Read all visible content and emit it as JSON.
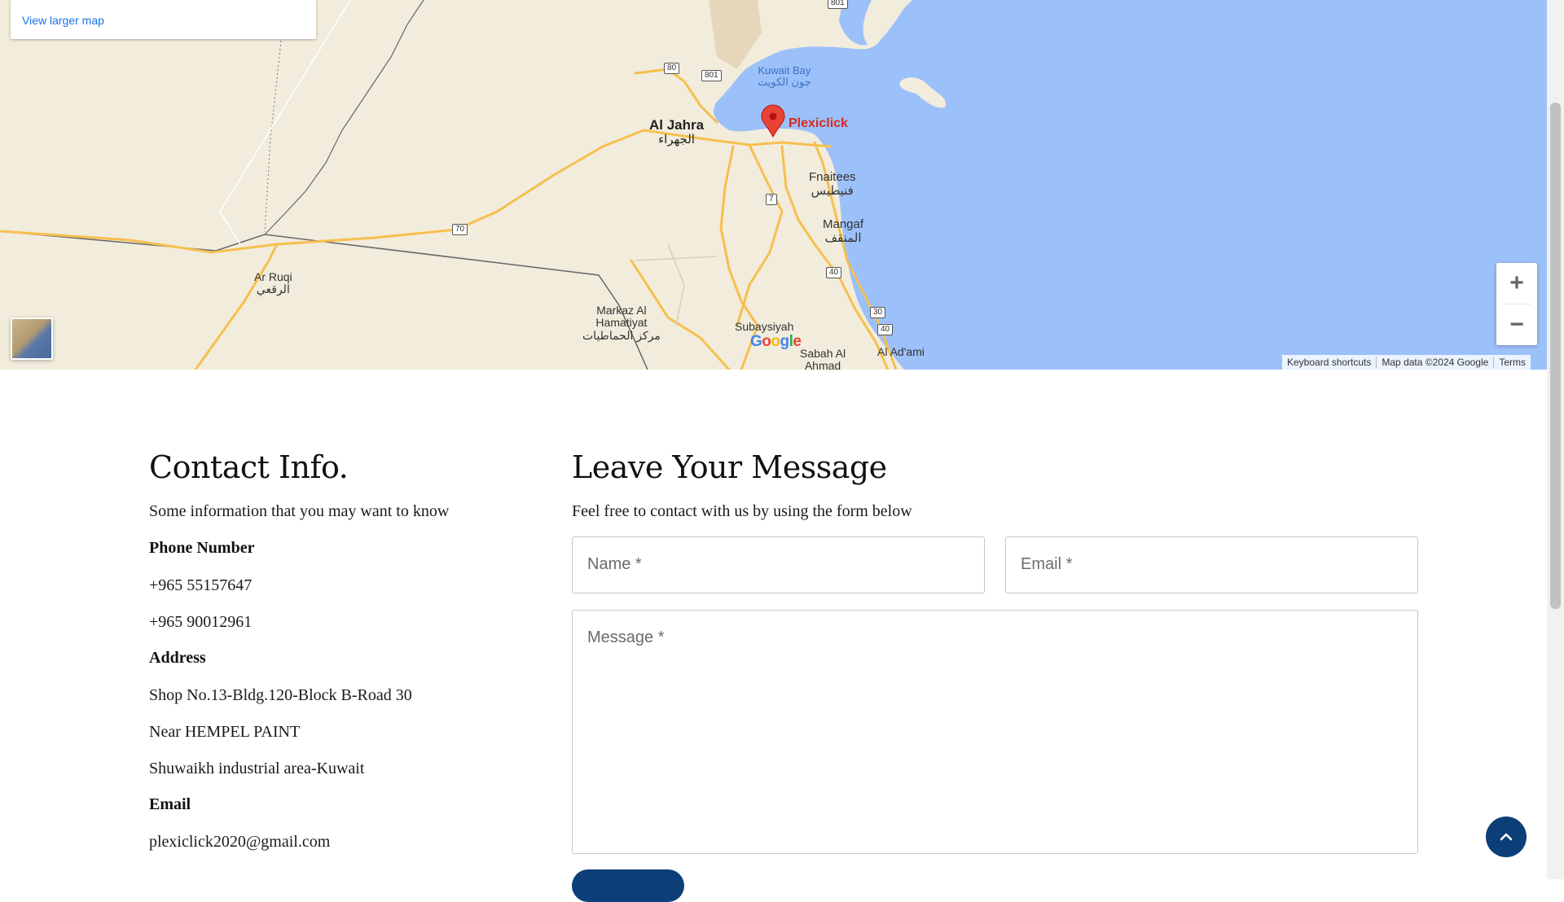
{
  "map": {
    "view_larger_label": "View larger map",
    "marker_label": "Plexiclick",
    "places": {
      "al_jahra": "Al Jahra",
      "al_jahra_ar": "الجهراء",
      "kuwait_bay": "Kuwait Bay",
      "kuwait_bay_ar": "جون الكويت",
      "fnaitees": "Fnaitees",
      "fnaitees_ar": "فنيطيس",
      "mangaf": "Mangaf",
      "mangaf_ar": "المنقف",
      "ar_ruqi": "Ar Ruqi",
      "ar_ruqi_ar": "الرقعي",
      "markaz_1": "Markaz Al",
      "markaz_2": "Hamatiyat",
      "markaz_ar": "مركز الحماطيات",
      "subaysiyah": "Subaysiyah",
      "sabah_al_ahmad_1": "Sabah Al",
      "sabah_al_ahmad_2": "Ahmad",
      "al_adami": "Al Ad'ami"
    },
    "road_shields": [
      "801",
      "80",
      "801",
      "70",
      "7",
      "40",
      "30",
      "40"
    ],
    "zoom_in": "+",
    "zoom_out": "−",
    "google_logo_letters": [
      "G",
      "o",
      "o",
      "g",
      "l",
      "e"
    ],
    "google_logo_colors": [
      "#4285F4",
      "#EA4335",
      "#FBBC05",
      "#4285F4",
      "#34A853",
      "#EA4335"
    ],
    "attribution": {
      "shortcuts": "Keyboard shortcuts",
      "data": "Map data ©2024 Google",
      "terms": "Terms"
    },
    "colors": {
      "land": "#f2ecdc",
      "water": "#9cc0f9",
      "road": "#f6c04e",
      "marker": "#ea4335"
    }
  },
  "contact_info": {
    "title": "Contact Info.",
    "subtitle": "Some information that you may want to know",
    "phone_label": "Phone Number",
    "phones": [
      "+965 55157647",
      "+965 90012961"
    ],
    "address_label": "Address",
    "address_lines": [
      "Shop No.13-Bldg.120-Block B-Road 30",
      "Near HEMPEL PAINT",
      "Shuwaikh industrial area-Kuwait"
    ],
    "email_label": "Email",
    "email": "plexiclick2020@gmail.com"
  },
  "message_form": {
    "title": "Leave Your Message",
    "subtitle": "Feel free to contact with us by using the form below",
    "name_placeholder": "Name *",
    "email_placeholder": "Email *",
    "message_placeholder": "Message *"
  },
  "accent_color": "#0c3f78",
  "icons": {
    "back_to_top": "chevron-up-icon",
    "zoom_in": "plus-icon",
    "zoom_out": "minus-icon",
    "marker": "map-pin-icon"
  }
}
